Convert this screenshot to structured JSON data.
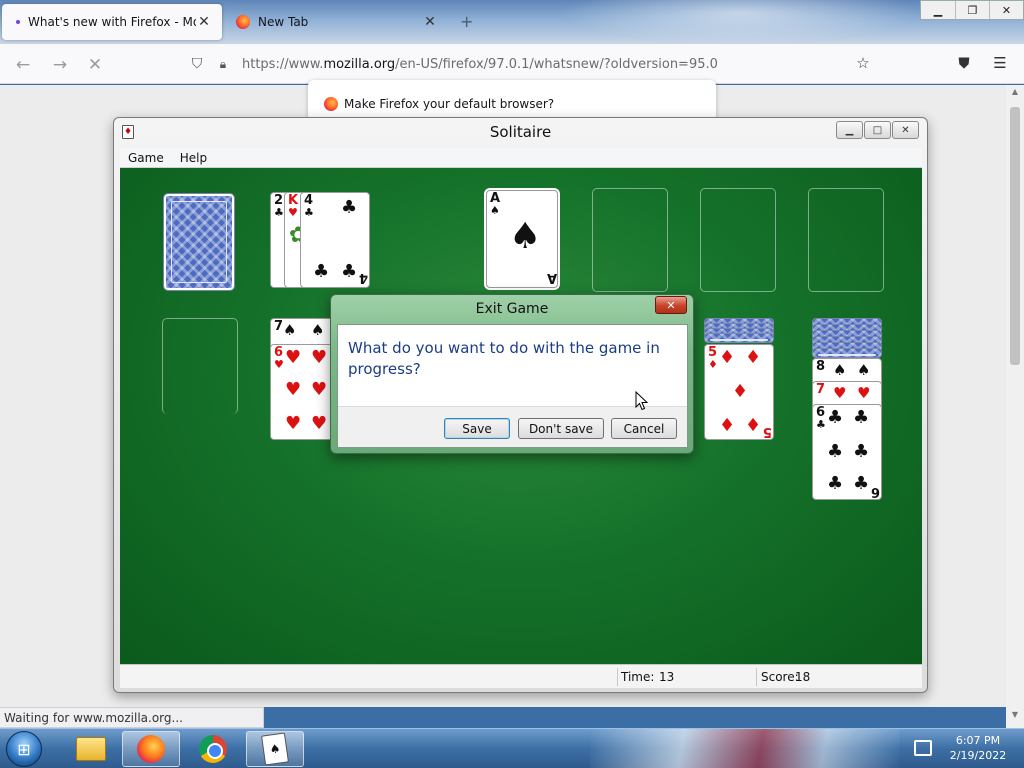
{
  "browser": {
    "tabs": [
      {
        "label": "What's new with Firefox - More",
        "active": true
      },
      {
        "label": "New Tab",
        "active": false
      }
    ],
    "url_prefix": "https://www.",
    "url_domain": "mozilla.org",
    "url_rest": "/en-US/firefox/97.0.1/whatsnew/?oldversion=95.0",
    "default_prompt": "Make Firefox your default browser?",
    "status": "Waiting for www.mozilla.org..."
  },
  "solitaire": {
    "title": "Solitaire",
    "menu": [
      "Game",
      "Help"
    ],
    "time_label": "Time:",
    "time_value": "13",
    "score_label": "Score:",
    "score_value": "18"
  },
  "dialog": {
    "title": "Exit Game",
    "close_label": "✕",
    "message": "What do you want to do with the game in progress?",
    "buttons": {
      "save": "Save",
      "dont_save": "Don't save",
      "cancel": "Cancel"
    }
  },
  "taskbar": {
    "time": "6:07 PM",
    "date": "2/19/2022"
  },
  "icons": {
    "tab_close": "close-icon",
    "reload_stop": "stop-icon",
    "bookmark": "star-icon",
    "pocket": "pocket-icon",
    "menu": "hamburger-menu-icon"
  },
  "colors": {
    "felt": "#15722a",
    "dialog_text": "#1a3d88",
    "card_red": "#dd1111"
  }
}
